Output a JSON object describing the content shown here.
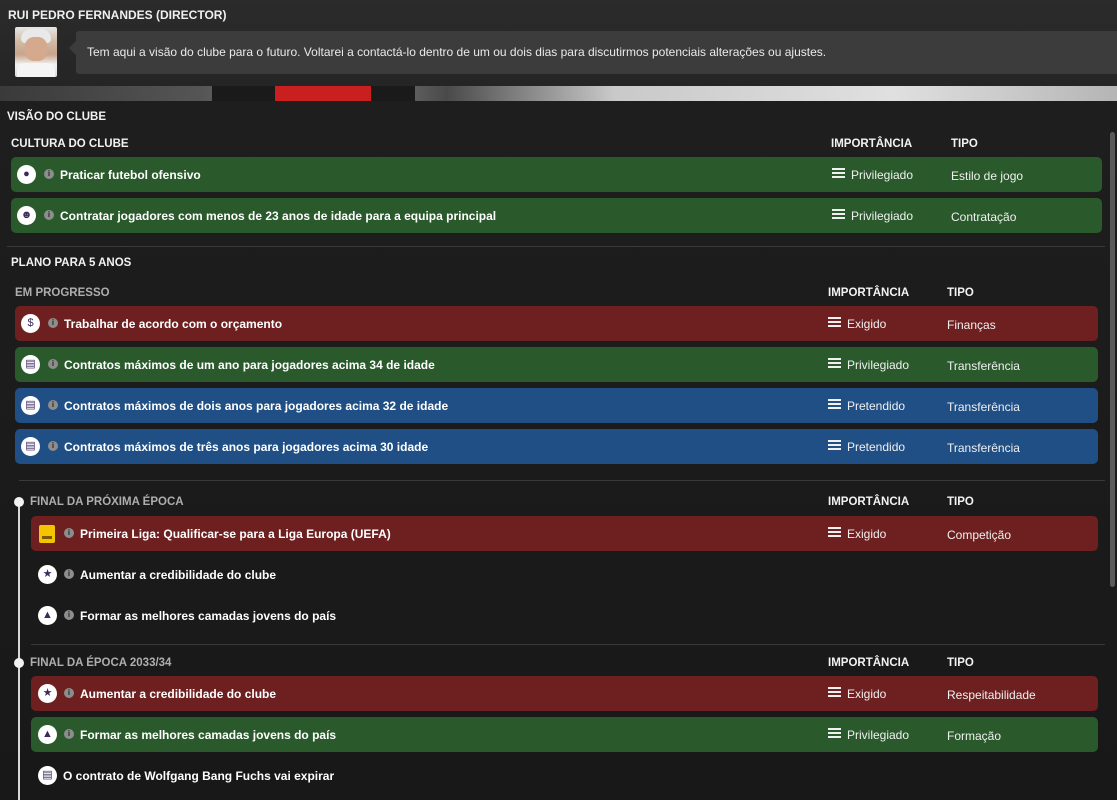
{
  "director": {
    "name": "RUI PEDRO FERNANDES (DIRECTOR)",
    "message": "Tem aqui a visão do clube para o futuro. Voltarei a contactá-lo dentro de um ou dois dias para discutirmos potenciais alterações ou ajustes."
  },
  "vision": {
    "title": "VISÃO DO CLUBE",
    "culture": {
      "title": "CULTURA DO CLUBE",
      "col_importance": "IMPORTÂNCIA",
      "col_type": "TIPO",
      "items": [
        {
          "label": "Praticar futebol ofensivo",
          "importance": "Privilegiado",
          "type": "Estilo de jogo",
          "icon": "football-icon"
        },
        {
          "label": "Contratar jogadores com menos de 23 anos de idade para a equipa principal",
          "importance": "Privilegiado",
          "type": "Contratação",
          "icon": "person-icon"
        }
      ]
    },
    "plan": {
      "title": "PLANO PARA 5 ANOS",
      "in_progress": {
        "title": "EM PROGRESSO",
        "col_importance": "IMPORTÂNCIA",
        "col_type": "TIPO",
        "items": [
          {
            "label": "Trabalhar de acordo com o orçamento",
            "importance": "Exigido",
            "type": "Finanças",
            "icon": "money-icon"
          },
          {
            "label": "Contratos máximos de um ano para jogadores acima 34 de idade",
            "importance": "Privilegiado",
            "type": "Transferência",
            "icon": "contract-icon"
          },
          {
            "label": "Contratos máximos de dois anos para jogadores acima 32 de idade",
            "importance": "Pretendido",
            "type": "Transferência",
            "icon": "contract-icon"
          },
          {
            "label": "Contratos máximos de três anos para jogadores acima 30 idade",
            "importance": "Pretendido",
            "type": "Transferência",
            "icon": "contract-icon"
          }
        ]
      },
      "next_season": {
        "title": "FINAL DA PRÓXIMA ÉPOCA",
        "col_importance": "IMPORTÂNCIA",
        "col_type": "TIPO",
        "items": [
          {
            "label": "Primeira Liga: Qualificar-se para a Liga Europa (UEFA)",
            "importance": "Exigido",
            "type": "Competição",
            "icon": "trophy-icon"
          },
          {
            "label": "Aumentar a credibilidade do clube",
            "icon": "star-icon"
          },
          {
            "label": "Formar as melhores camadas jovens do país",
            "icon": "graduation-cap-icon"
          }
        ]
      },
      "season_2033": {
        "title": "FINAL DA ÉPOCA 2033/34",
        "col_importance": "IMPORTÂNCIA",
        "col_type": "TIPO",
        "items": [
          {
            "label": "Aumentar a credibilidade do clube",
            "importance": "Exigido",
            "type": "Respeitabilidade",
            "icon": "star-icon"
          },
          {
            "label": "Formar as melhores camadas jovens do país",
            "importance": "Privilegiado",
            "type": "Formação",
            "icon": "graduation-cap-icon"
          },
          {
            "label": "O contrato de Wolfgang Bang Fuchs vai expirar",
            "icon": "contract-icon"
          }
        ]
      }
    }
  },
  "colors": {
    "green": "#2a5a2c",
    "red": "#6e2020",
    "blue": "#1f4f85"
  }
}
